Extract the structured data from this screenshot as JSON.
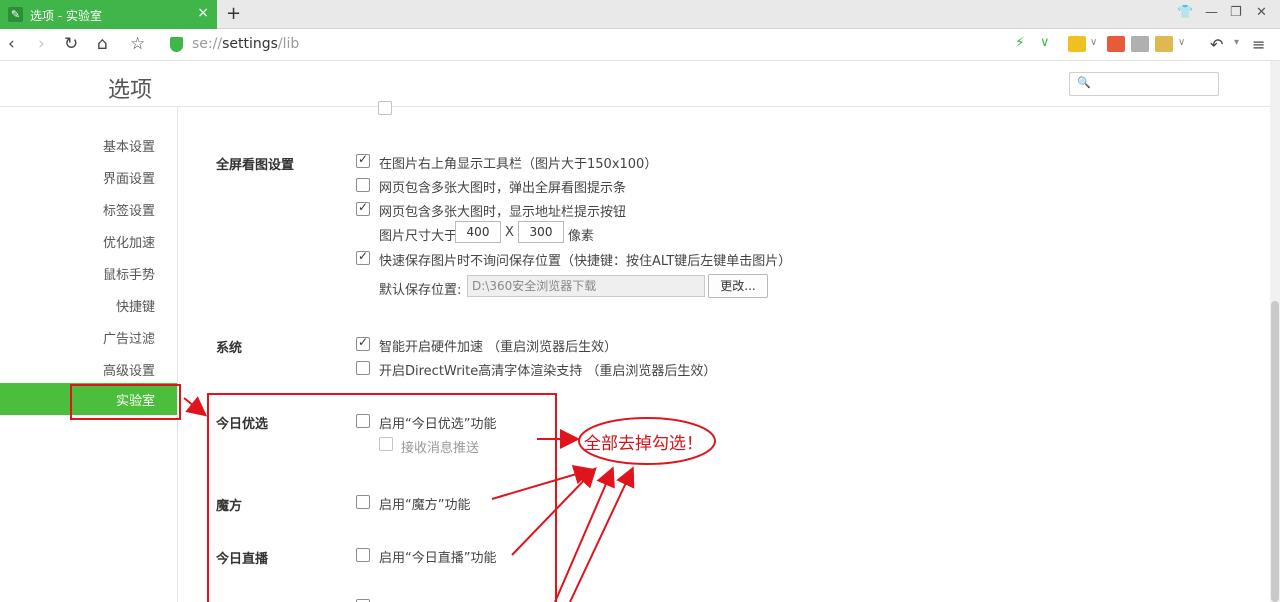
{
  "tab": {
    "title": "选项 - 实验室",
    "close": "×"
  },
  "tabbar": {
    "new_tab": "+",
    "shirt": "👕",
    "minimize": "—",
    "restore": "❐",
    "close": "✕"
  },
  "nav": {
    "back": "‹",
    "forward": "›",
    "reload": "↻",
    "home": "⌂",
    "star": "☆"
  },
  "address": {
    "scheme": "se://",
    "path": "settings",
    "suffix": "/lib"
  },
  "toolbar": {
    "undo": "↶",
    "menu": "≡"
  },
  "header": {
    "title": "选项",
    "search_placeholder": ""
  },
  "sidebar": {
    "items": [
      {
        "label": "基本设置"
      },
      {
        "label": "界面设置"
      },
      {
        "label": "标签设置"
      },
      {
        "label": "优化加速"
      },
      {
        "label": "鼠标手势"
      },
      {
        "label": "快捷键"
      },
      {
        "label": "广告过滤"
      },
      {
        "label": "高级设置"
      },
      {
        "label": "实验室",
        "active": true
      }
    ]
  },
  "fullscreen": {
    "section": "全屏看图设置",
    "opt1": "在图片右上角显示工具栏（图片大于150x100）",
    "opt2": "网页包含多张大图时，弹出全屏看图提示条",
    "opt3": "网页包含多张大图时，显示地址栏提示按钮",
    "size_label": "图片尺寸大于",
    "width": "400",
    "x": "X",
    "height": "300",
    "unit": "像素",
    "opt4": "快速保存图片时不询问保存位置（快捷键：按住ALT键后左键单击图片）",
    "save_label": "默认保存位置:",
    "save_path": "D:\\360安全浏览器下载",
    "change_button": "更改..."
  },
  "system": {
    "section": "系统",
    "opt1": "智能开启硬件加速 （重启浏览器后生效）",
    "opt2": "开启DirectWrite高清字体渲染支持 （重启浏览器后生效）"
  },
  "today_pick": {
    "section": "今日优选",
    "opt1": "启用“今日优选”功能",
    "sub": "接收消息推送"
  },
  "magic_cube": {
    "section": "魔方",
    "opt1": "启用“魔方”功能"
  },
  "today_live": {
    "section": "今日直播",
    "opt1": "启用“今日直播”功能"
  },
  "annotation": {
    "text": "全部去掉勾选！"
  },
  "colors": {
    "accent": "#3fb54a",
    "annotation": "#e0141c"
  }
}
